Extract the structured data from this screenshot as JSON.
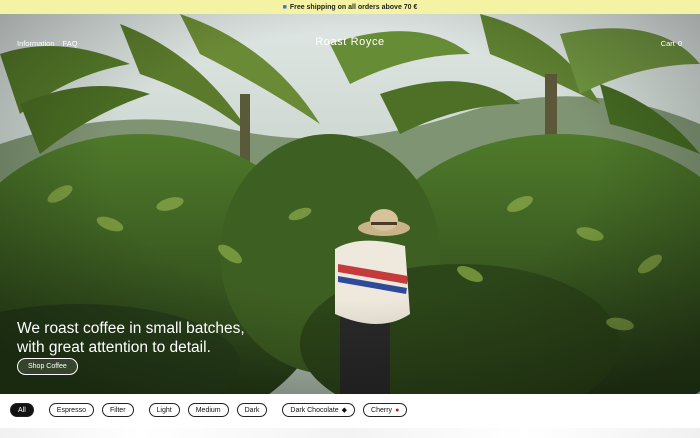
{
  "banner": {
    "icon": "truck-icon",
    "text": "Free shipping on all orders above 70 €"
  },
  "nav": {
    "links": [
      "Information",
      "FAQ"
    ],
    "brand": "Roast Royce",
    "cart_label": "Cart",
    "cart_count": "0"
  },
  "hero": {
    "headline_line1": "We roast coffee in small batches,",
    "headline_line2": "with great attention to detail.",
    "cta_label": "Shop Coffee"
  },
  "filters": {
    "items": [
      {
        "label": "All",
        "active": true
      },
      {
        "label": "Espresso"
      },
      {
        "label": "Filter"
      },
      {
        "label": "Light"
      },
      {
        "label": "Medium"
      },
      {
        "label": "Dark"
      },
      {
        "label": "Dark Chocolate",
        "icon": "chocolate-icon"
      },
      {
        "label": "Cherry",
        "icon": "cherry-icon"
      }
    ]
  },
  "colors": {
    "banner_bg": "#f4f3a4",
    "active_chip": "#111111"
  }
}
